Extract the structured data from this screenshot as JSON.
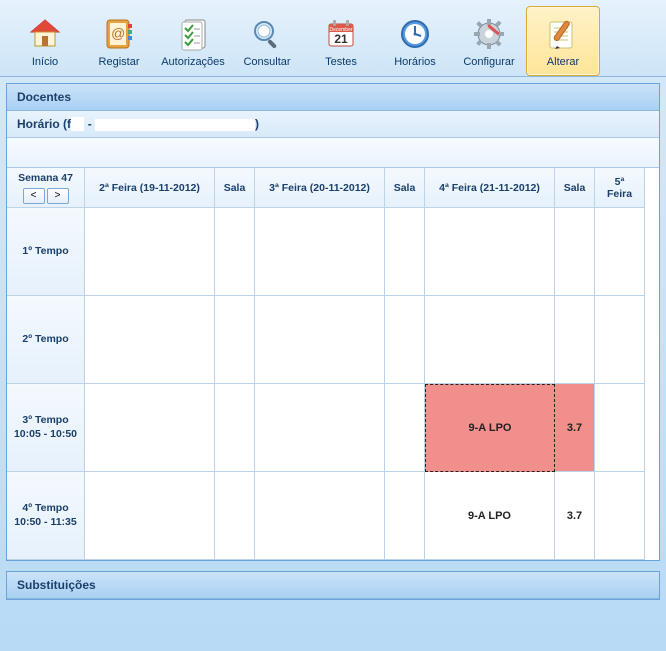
{
  "toolbar": {
    "inicio": "Início",
    "registar": "Registar",
    "autorizacoes": "Autorizações",
    "consultar": "Consultar",
    "testes": "Testes",
    "horarios": "Horários",
    "configurar": "Configurar",
    "alterar": "Alterar"
  },
  "sections": {
    "docentes": "Docentes",
    "horario_label": "Horário (f",
    "horario_sep": " - ",
    "horario_tail": ")",
    "subs": "Substituições"
  },
  "grid_headers": {
    "week": "Semana 47",
    "prev": "<",
    "next": ">",
    "c1": "2ª Feira (19-11-2012)",
    "sala": "Sala",
    "c2": "3ª Feira (20-11-2012)",
    "c3": "4ª Feira (21-11-2012)",
    "c4": "5ª Feira"
  },
  "rows": {
    "r1": {
      "label": "1º Tempo",
      "time": ""
    },
    "r2": {
      "label": "2º Tempo",
      "time": ""
    },
    "r3": {
      "label": "3º Tempo",
      "time": "10:05 - 10:50"
    },
    "r4": {
      "label": "4º Tempo",
      "time": "10:50 - 11:35"
    }
  },
  "cells": {
    "r3c3": "9-A LPO",
    "r3s3": "3.7",
    "r4c3": "9-A LPO",
    "r4s3": "3.7"
  }
}
